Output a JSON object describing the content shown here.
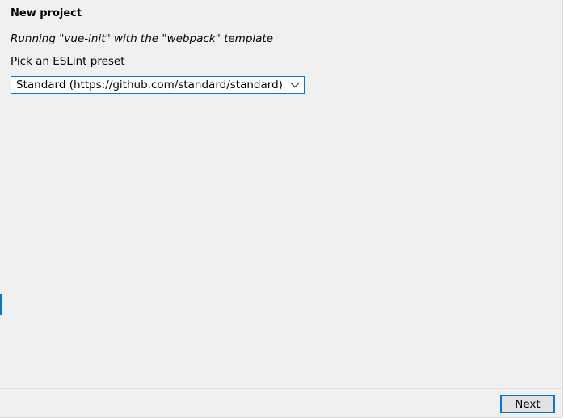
{
  "dialog": {
    "title": "New project",
    "subtitle": "Running \"vue-init\" with the \"webpack\" template",
    "prompt_label": "Pick an ESLint preset",
    "preset_select": {
      "selected_value": "Standard (https://github.com/standard/standard)",
      "icon": "chevron-down-icon"
    }
  },
  "footer": {
    "next_label": "Next"
  },
  "colors": {
    "background": "#f0f0f0",
    "accent": "#0078d7",
    "button_face": "#e1e1e1"
  }
}
